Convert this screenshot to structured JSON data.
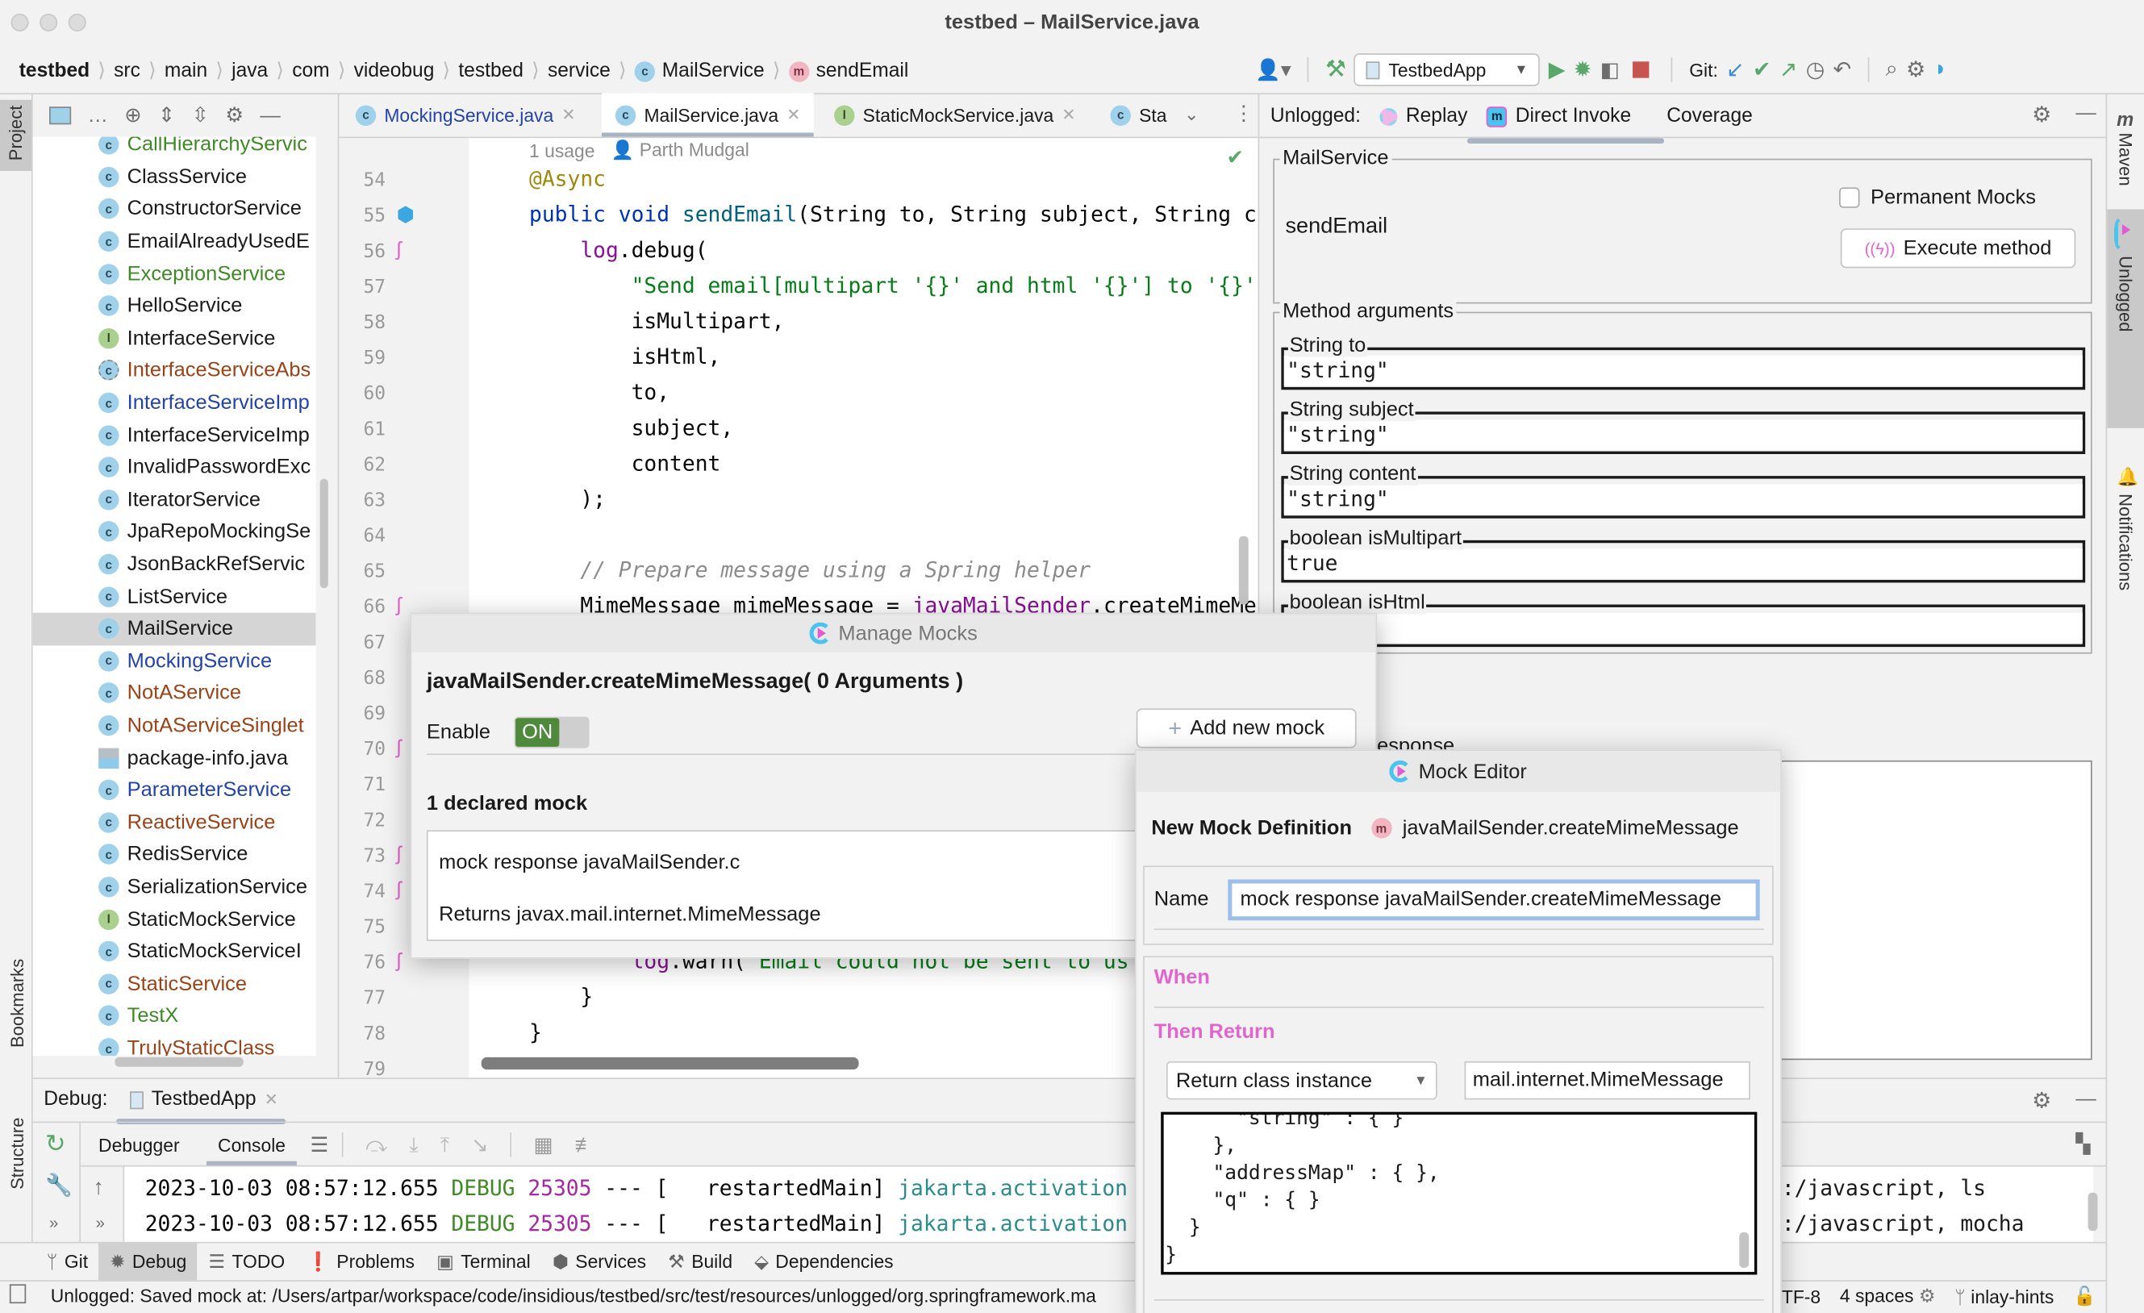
{
  "window": {
    "title": "testbed – MailService.java"
  },
  "breadcrumb": [
    {
      "label": "testbed",
      "bold": true
    },
    {
      "label": "src"
    },
    {
      "label": "main"
    },
    {
      "label": "java"
    },
    {
      "label": "com"
    },
    {
      "label": "videobug"
    },
    {
      "label": "testbed"
    },
    {
      "label": "service"
    },
    {
      "label": "MailService",
      "icon": "class-icon"
    },
    {
      "label": "sendEmail",
      "icon": "method-icon"
    }
  ],
  "toolbar": {
    "run_config": "TestbedApp",
    "git_label": "Git:"
  },
  "left_strip": {
    "project": "Project",
    "bookmarks": "Bookmarks",
    "structure": "Structure"
  },
  "right_strip": {
    "maven": "Maven",
    "unlogged": "Unlogged",
    "notifications": "Notifications"
  },
  "project_tree": {
    "selected": "MailService",
    "colors": {
      "default": "#1a1a1a",
      "green": "#3f8a26",
      "brown": "#9a4318",
      "blue": "#2343a8"
    },
    "items": [
      {
        "label": "CallHierarchyServic",
        "color": "green",
        "kind": "class"
      },
      {
        "label": "ClassService",
        "color": "default",
        "kind": "class"
      },
      {
        "label": "ConstructorService",
        "color": "default",
        "kind": "class"
      },
      {
        "label": "EmailAlreadyUsedE",
        "color": "default",
        "kind": "class"
      },
      {
        "label": "ExceptionService",
        "color": "green",
        "kind": "class"
      },
      {
        "label": "HelloService",
        "color": "default",
        "kind": "class"
      },
      {
        "label": "InterfaceService",
        "color": "default",
        "kind": "interface"
      },
      {
        "label": "InterfaceServiceAbs",
        "color": "brown",
        "kind": "abstract"
      },
      {
        "label": "InterfaceServiceImp",
        "color": "blue",
        "kind": "class"
      },
      {
        "label": "InterfaceServiceImp",
        "color": "default",
        "kind": "class"
      },
      {
        "label": "InvalidPasswordExc",
        "color": "default",
        "kind": "class"
      },
      {
        "label": "IteratorService",
        "color": "default",
        "kind": "class"
      },
      {
        "label": "JpaRepoMockingSe",
        "color": "default",
        "kind": "class"
      },
      {
        "label": "JsonBackRefServic",
        "color": "default",
        "kind": "class"
      },
      {
        "label": "ListService",
        "color": "default",
        "kind": "class"
      },
      {
        "label": "MailService",
        "color": "default",
        "kind": "class"
      },
      {
        "label": "MockingService",
        "color": "blue",
        "kind": "class"
      },
      {
        "label": "NotAService",
        "color": "brown",
        "kind": "class"
      },
      {
        "label": "NotAServiceSinglet",
        "color": "brown",
        "kind": "class"
      },
      {
        "label": "package-info.java",
        "color": "default",
        "kind": "file"
      },
      {
        "label": "ParameterService",
        "color": "blue",
        "kind": "class"
      },
      {
        "label": "ReactiveService",
        "color": "brown",
        "kind": "class"
      },
      {
        "label": "RedisService",
        "color": "default",
        "kind": "class"
      },
      {
        "label": "SerializationService",
        "color": "default",
        "kind": "class"
      },
      {
        "label": "StaticMockService",
        "color": "default",
        "kind": "interface"
      },
      {
        "label": "StaticMockServiceI",
        "color": "default",
        "kind": "class"
      },
      {
        "label": "StaticService",
        "color": "brown",
        "kind": "class"
      },
      {
        "label": "TestX",
        "color": "green",
        "kind": "class"
      },
      {
        "label": "TrulyStaticClass",
        "color": "brown",
        "kind": "class"
      }
    ]
  },
  "editor": {
    "tabs": [
      {
        "label": "MockingService.java",
        "kind": "class",
        "active": false,
        "color": "#2343a8"
      },
      {
        "label": "MailService.java",
        "kind": "class",
        "active": true,
        "color": "#1a1a1a"
      },
      {
        "label": "StaticMockService.java",
        "kind": "interface",
        "active": false,
        "color": "#1a1a1a"
      },
      {
        "label": "Sta",
        "kind": "class",
        "active": false,
        "color": "#1a1a1a"
      }
    ],
    "inlay": {
      "usages": "1 usage",
      "author": "Parth Mudgal"
    },
    "lines": [
      {
        "n": "54",
        "tokens": [
          [
            "an",
            "@Async"
          ]
        ]
      },
      {
        "n": "55",
        "tokens": [
          [
            "kw",
            "public void "
          ],
          [
            "fn",
            "sendEmail"
          ],
          [
            "",
            "(String to, String subject, String c"
          ]
        ],
        "gutter": "interface-impl-icon"
      },
      {
        "n": "56",
        "tokens": [
          [
            "",
            "    "
          ],
          [
            "fd",
            "log"
          ],
          [
            "",
            ".debug("
          ]
        ],
        "gutter": "unlogged-probe-icon"
      },
      {
        "n": "57",
        "tokens": [
          [
            "",
            "        "
          ],
          [
            "st",
            "\"Send email[multipart '{}' and html '{}'] to '{}'"
          ]
        ]
      },
      {
        "n": "58",
        "tokens": [
          [
            "",
            "        isMultipart,"
          ]
        ]
      },
      {
        "n": "59",
        "tokens": [
          [
            "",
            "        isHtml,"
          ]
        ]
      },
      {
        "n": "60",
        "tokens": [
          [
            "",
            "        to,"
          ]
        ]
      },
      {
        "n": "61",
        "tokens": [
          [
            "",
            "        subject,"
          ]
        ]
      },
      {
        "n": "62",
        "tokens": [
          [
            "",
            "        content"
          ]
        ]
      },
      {
        "n": "63",
        "tokens": [
          [
            "",
            "    );"
          ]
        ]
      },
      {
        "n": "64",
        "tokens": []
      },
      {
        "n": "65",
        "tokens": [
          [
            "",
            "    "
          ],
          [
            "cm",
            "// Prepare message using a Spring helper"
          ]
        ]
      },
      {
        "n": "66",
        "tokens": [
          [
            "",
            "    MimeMessage mimeMessage = "
          ],
          [
            "fd",
            "javaMailSender"
          ],
          [
            "",
            ".createMimeMe"
          ]
        ],
        "gutter": "unlogged-probe-icon"
      },
      {
        "n": "67",
        "tokens": []
      },
      {
        "n": "68",
        "tokens": []
      },
      {
        "n": "69",
        "tokens": []
      },
      {
        "n": "70",
        "tokens": [],
        "gutter": "unlogged-probe-icon"
      },
      {
        "n": "71",
        "tokens": []
      },
      {
        "n": "72",
        "tokens": []
      },
      {
        "n": "73",
        "tokens": [],
        "gutter": "unlogged-probe-icon"
      },
      {
        "n": "74",
        "tokens": [],
        "gutter": "unlogged-probe-icon"
      },
      {
        "n": "75",
        "tokens": []
      },
      {
        "n": "76",
        "tokens": [
          [
            "",
            "        "
          ],
          [
            "fd",
            "log"
          ],
          [
            "",
            ".warn("
          ],
          [
            "st",
            "\"Email could not be sent to us"
          ]
        ],
        "gutter": "unlogged-probe-icon"
      },
      {
        "n": "77",
        "tokens": [
          [
            "",
            "    }"
          ]
        ]
      },
      {
        "n": "78",
        "tokens": [
          [
            "",
            "}"
          ]
        ]
      },
      {
        "n": "79",
        "tokens": []
      }
    ]
  },
  "unlogged": {
    "header_label": "Unlogged:",
    "tabs": [
      {
        "label": "Replay"
      },
      {
        "label": "Direct Invoke",
        "active": true
      },
      {
        "label": "Coverage"
      }
    ],
    "class_group": "MailService",
    "method": "sendEmail",
    "permanent_mocks": {
      "label": "Permanent Mocks",
      "checked": false
    },
    "execute_label": "Execute method",
    "args_group": "Method arguments",
    "args": [
      {
        "label": "String to",
        "value": "\"string\""
      },
      {
        "label": "String subject",
        "value": "\"string\""
      },
      {
        "label": "String content",
        "value": "\"string\""
      },
      {
        "label": "boolean isMultipart",
        "value": "true"
      },
      {
        "label": "boolean isHtml",
        "value": ""
      }
    ],
    "response_label": "esponse"
  },
  "manage_mocks": {
    "title": "Manage Mocks",
    "signature": "javaMailSender.createMimeMessage( 0 Arguments )",
    "enable_label": "Enable",
    "toggle": "ON",
    "enabled": true,
    "add_label": "Add new mock",
    "declared_count": "1 declared mock",
    "mocks": [
      {
        "name": "mock response javaMailSender.c",
        "returns": "Returns javax.mail.internet.MimeMessage"
      }
    ]
  },
  "mock_editor": {
    "title": "Mock Editor",
    "heading": "New Mock Definition",
    "target": "javaMailSender.createMimeMessage",
    "name_label": "Name",
    "name_value": "mock response javaMailSender.createMimeMessage",
    "when_label": "When",
    "then_label": "Then Return",
    "return_type": "Return class instance",
    "return_class": "mail.internet.MimeMessage",
    "json": "      \"string\" : { }\n    },\n    \"addressMap\" : { },\n    \"q\" : { }\n  }\n}",
    "accent": "#e066cc"
  },
  "debug": {
    "label": "Debug:",
    "session": "TestbedApp",
    "tabs": [
      {
        "label": "Debugger"
      },
      {
        "label": "Console",
        "active": true
      }
    ],
    "console": [
      {
        "ts": "2023-10-03 08:57:12.655",
        "level": "DEBUG",
        "pid": "25305",
        "sep": "--- [",
        "thread": "  restartedMain]",
        "logger": "jakarta.activation",
        "tail": ":/javascript, ls"
      },
      {
        "ts": "2023-10-03 08:57:12.655",
        "level": "DEBUG",
        "pid": "25305",
        "sep": "--- [",
        "thread": "  restartedMain]",
        "logger": "jakarta.activation",
        "tail": ":/javascript, mocha"
      }
    ]
  },
  "tool_windows": [
    {
      "label": "Git",
      "icon": "git-branch-icon"
    },
    {
      "label": "Debug",
      "icon": "bug-icon",
      "active": true
    },
    {
      "label": "TODO",
      "icon": "list-icon"
    },
    {
      "label": "Problems",
      "icon": "warning-icon"
    },
    {
      "label": "Terminal",
      "icon": "terminal-icon"
    },
    {
      "label": "Services",
      "icon": "services-icon"
    },
    {
      "label": "Build",
      "icon": "hammer-icon"
    },
    {
      "label": "Dependencies",
      "icon": "dependencies-icon"
    }
  ],
  "status": {
    "message": "Unlogged: Saved mock at: /Users/artpar/workspace/code/insidious/testbed/src/test/resources/unlogged/org.springframework.ma",
    "encoding": "TF-8",
    "indent": "4 spaces",
    "branch": "inlay-hints"
  }
}
